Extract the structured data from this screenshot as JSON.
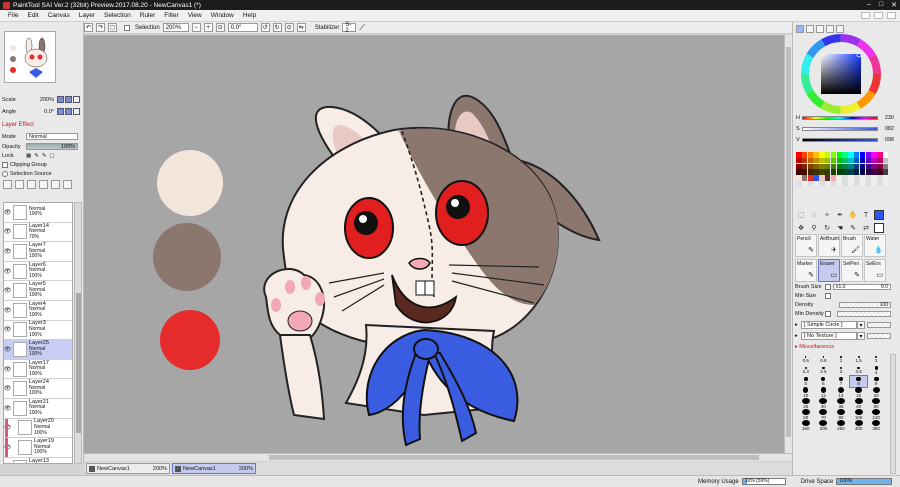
{
  "title": "PaintTool SAI Ver.2 (32bit) Preview.2017.08.20 - NewCanvas1 (*)",
  "menu": [
    "File",
    "Edit",
    "Canvas",
    "Layer",
    "Selection",
    "Ruler",
    "Filter",
    "View",
    "Window",
    "Help"
  ],
  "toolbar": {
    "selection_label": "Selection",
    "zoom": "200%",
    "angle": "0.0°",
    "stabilizer_label": "Stabilizer",
    "stabilizer_value": "S-2"
  },
  "navigator": {
    "scale_label": "Scale",
    "scale_value": "200%",
    "angle_label": "Angle",
    "angle_value": "0.0°"
  },
  "layer_effect": {
    "title": "Layer Effect",
    "mode_label": "Mode",
    "mode_value": "Normal",
    "opacity_label": "Opacity",
    "opacity_value": "100%",
    "lock_label": "Lock",
    "clipping_group_label": "Clipping Group",
    "selection_source_label": "Selection Source"
  },
  "layers": [
    {
      "name": "",
      "mode": "Normal",
      "opacity": "100%",
      "clip": false,
      "selected": false
    },
    {
      "name": "Layer14",
      "mode": "Normal",
      "opacity": "70%",
      "clip": false,
      "selected": false
    },
    {
      "name": "Layer7",
      "mode": "Normal",
      "opacity": "100%",
      "clip": false,
      "selected": false
    },
    {
      "name": "Layer6",
      "mode": "Normal",
      "opacity": "100%",
      "clip": false,
      "selected": false
    },
    {
      "name": "Layer5",
      "mode": "Normal",
      "opacity": "100%",
      "clip": false,
      "selected": false
    },
    {
      "name": "Layer4",
      "mode": "Normal",
      "opacity": "100%",
      "clip": false,
      "selected": false
    },
    {
      "name": "Layer3",
      "mode": "Normal",
      "opacity": "100%",
      "clip": false,
      "selected": false
    },
    {
      "name": "Layer25",
      "mode": "Normal",
      "opacity": "100%",
      "clip": false,
      "selected": true
    },
    {
      "name": "Layer17",
      "mode": "Normal",
      "opacity": "100%",
      "clip": false,
      "selected": false
    },
    {
      "name": "Layer24",
      "mode": "Normal",
      "opacity": "100%",
      "clip": false,
      "selected": false
    },
    {
      "name": "Layer21",
      "mode": "Normal",
      "opacity": "100%",
      "clip": false,
      "selected": false
    },
    {
      "name": "Layer20",
      "mode": "Normal",
      "opacity": "100%",
      "clip": true,
      "selected": false
    },
    {
      "name": "Layer19",
      "mode": "Normal",
      "opacity": "100%",
      "clip": true,
      "selected": false
    },
    {
      "name": "Layer13",
      "mode": "Normal",
      "opacity": "100%",
      "clip": false,
      "selected": false
    }
  ],
  "documents": [
    {
      "name": "NewCanvas1",
      "zoom": "200%",
      "active": false
    },
    {
      "name": "NewCanvas1",
      "zoom": "200%",
      "active": true
    }
  ],
  "status": {
    "memory_label": "Memory Usage",
    "memory_value": "10% (59%)",
    "memory_fraction": 0.1,
    "drive_label": "Drive Space",
    "drive_value": "100%",
    "drive_fraction": 1.0
  },
  "color": {
    "h_label": "H",
    "h_value": "230",
    "s_label": "S",
    "s_value": "082",
    "v_label": "V",
    "v_value": "098",
    "current": "#2f55f0",
    "palette_swatches": [
      "#f2e6dc",
      "#8c776f",
      "#e52b2b"
    ]
  },
  "brushes": [
    {
      "name": "Pencil",
      "icon": "✎",
      "selected": false
    },
    {
      "name": "AirBrush",
      "icon": "✈",
      "selected": false
    },
    {
      "name": "Brush",
      "icon": "🖌",
      "selected": false
    },
    {
      "name": "Water",
      "icon": "💧",
      "selected": false
    },
    {
      "name": "Marker",
      "icon": "✎",
      "selected": false
    },
    {
      "name": "Eraser",
      "icon": "▭",
      "selected": true
    },
    {
      "name": "SelPen",
      "icon": "✎",
      "selected": false
    },
    {
      "name": "SelErs",
      "icon": "▭",
      "selected": false
    }
  ],
  "brush_settings": {
    "size_label": "Brush Size",
    "size_mult": "x1.0",
    "size_value": "8.0",
    "min_size_label": "Min Size",
    "density_label": "Density",
    "density_value": "100",
    "min_density_label": "Min Density",
    "shape": "[ Simple Circle ]",
    "texture": "[ No Texture ]",
    "misc_label": "Miscellaneous"
  },
  "sizes": [
    "0.6",
    "0.8",
    "1",
    "1.5",
    "2",
    "2.3",
    "2.6",
    "3",
    "3.5",
    "4",
    "5",
    "6",
    "7",
    "8",
    "9",
    "10",
    "12",
    "14",
    "16",
    "20",
    "25",
    "30",
    "35",
    "40",
    "50",
    "60",
    "70",
    "80",
    "100",
    "120",
    "160",
    "200",
    "250",
    "300",
    "350"
  ],
  "selected_size": "8"
}
